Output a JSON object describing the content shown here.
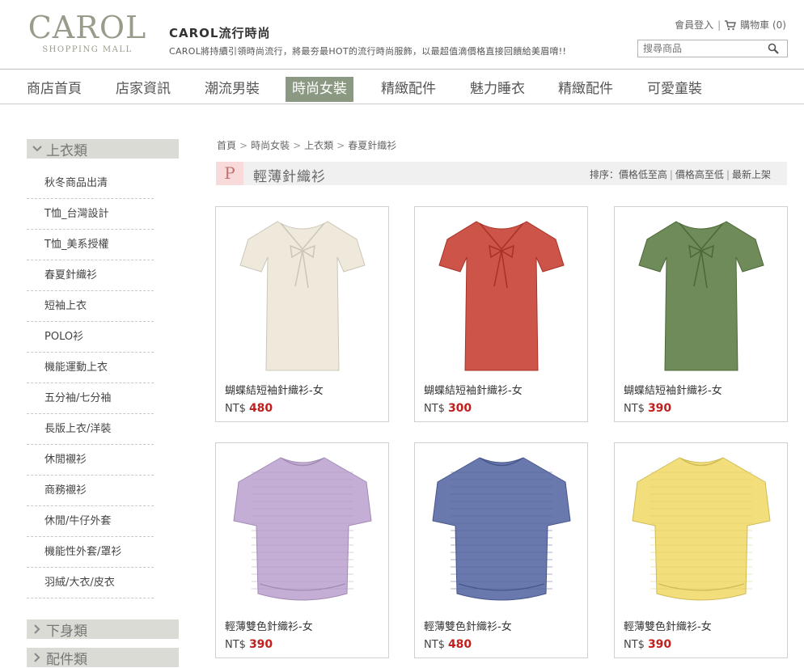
{
  "header": {
    "logo_text": "CAROL",
    "logo_sub": "SHOPPING MALL",
    "site_title": "CAROL流行時尚",
    "site_desc": "CAROL將持續引領時尚流行，將最夯最HOT的流行時尚服飾，以最超值滴價格直接回饋給美眉唷!!",
    "member_login": "會員登入",
    "separator": "|",
    "cart_label": "購物車 (0)",
    "search_placeholder": "搜尋商品"
  },
  "nav": {
    "items": [
      "商店首頁",
      "店家資訊",
      "潮流男裝",
      "時尚女裝",
      "精緻配件",
      "魅力睡衣",
      "精緻配件",
      "可愛童裝"
    ],
    "active_index": 3
  },
  "sidebar": {
    "category_open": "上衣類",
    "items": [
      "秋冬商品出清",
      "T恤_台灣設計",
      "T恤_美系授權",
      "春夏針織衫",
      "短袖上衣",
      "POLO衫",
      "機能運動上衣",
      "五分袖/七分袖",
      "長版上衣/洋裝",
      "休閒襯衫",
      "商務襯衫",
      "休閒/牛仔外套",
      "機能性外套/罩衫",
      "羽絨/大衣/皮衣"
    ],
    "category_2": "下身類",
    "category_3": "配件類"
  },
  "main": {
    "breadcrumb": [
      "首頁",
      "時尚女裝",
      "上衣類",
      "春夏針織衫"
    ],
    "badge": "P",
    "title": "輕薄針織衫",
    "sort_label": "排序：",
    "sort_options": [
      "價格低至高",
      "價格高至低",
      "最新上架"
    ],
    "currency": "NT$",
    "products": [
      {
        "name": "蝴蝶結短袖針織衫-女",
        "price": "480",
        "color": "#efe9dc",
        "style": "tee"
      },
      {
        "name": "蝴蝶結短袖針織衫-女",
        "price": "300",
        "color": "#cc5448",
        "style": "tee"
      },
      {
        "name": "蝴蝶結短袖針織衫-女",
        "price": "390",
        "color": "#6f8b5a",
        "style": "tee"
      },
      {
        "name": "輕薄雙色針織衫-女",
        "price": "390",
        "color": "#c4aed6",
        "style": "dolman"
      },
      {
        "name": "輕薄雙色針織衫-女",
        "price": "480",
        "color": "#6a79ad",
        "style": "dolman"
      },
      {
        "name": "輕薄雙色針織衫-女",
        "price": "390",
        "color": "#f2de7a",
        "style": "dolman"
      }
    ]
  },
  "colors": {
    "nav_active": "#8c9982",
    "price": "#c0201e",
    "sidebar_category": "#dadbd4",
    "badge_bg": "#f9dada"
  }
}
